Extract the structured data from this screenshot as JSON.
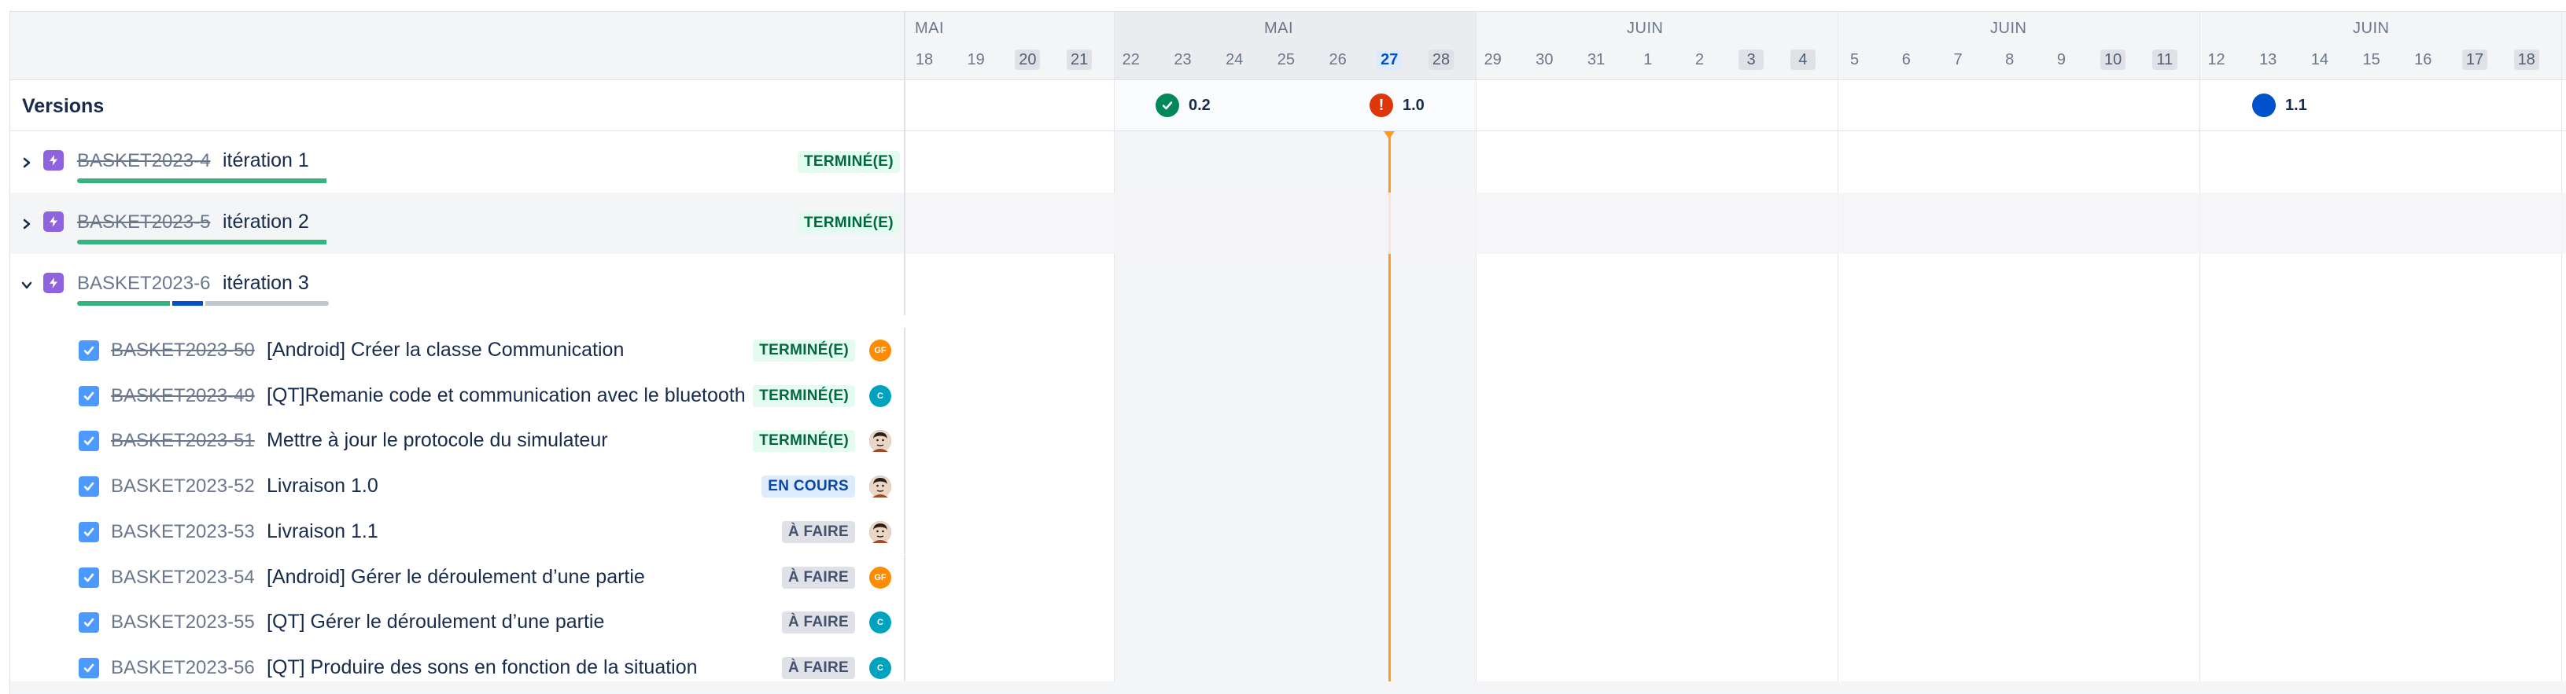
{
  "header": {
    "months": [
      {
        "label": "MAI"
      },
      {
        "label": "MAI"
      },
      {
        "label": "JUIN"
      },
      {
        "label": "JUIN"
      },
      {
        "label": "JUIN"
      }
    ],
    "days": [
      {
        "label": "18",
        "type": "normal"
      },
      {
        "label": "19",
        "type": "normal"
      },
      {
        "label": "20",
        "type": "weekend"
      },
      {
        "label": "21",
        "type": "weekend"
      },
      {
        "label": "22",
        "type": "normal"
      },
      {
        "label": "23",
        "type": "normal"
      },
      {
        "label": "24",
        "type": "normal"
      },
      {
        "label": "25",
        "type": "normal"
      },
      {
        "label": "26",
        "type": "normal"
      },
      {
        "label": "27",
        "type": "today"
      },
      {
        "label": "28",
        "type": "weekend"
      },
      {
        "label": "29",
        "type": "normal"
      },
      {
        "label": "30",
        "type": "normal"
      },
      {
        "label": "31",
        "type": "normal"
      },
      {
        "label": "1",
        "type": "normal"
      },
      {
        "label": "2",
        "type": "normal"
      },
      {
        "label": "3",
        "type": "weekend"
      },
      {
        "label": "4",
        "type": "weekend"
      },
      {
        "label": "5",
        "type": "normal"
      },
      {
        "label": "6",
        "type": "normal"
      },
      {
        "label": "7",
        "type": "normal"
      },
      {
        "label": "8",
        "type": "normal"
      },
      {
        "label": "9",
        "type": "normal"
      },
      {
        "label": "10",
        "type": "weekend"
      },
      {
        "label": "11",
        "type": "weekend"
      },
      {
        "label": "12",
        "type": "normal"
      },
      {
        "label": "13",
        "type": "normal"
      },
      {
        "label": "14",
        "type": "normal"
      },
      {
        "label": "15",
        "type": "normal"
      },
      {
        "label": "16",
        "type": "normal"
      },
      {
        "label": "17",
        "type": "weekend"
      },
      {
        "label": "18",
        "type": "weekend"
      }
    ]
  },
  "versions": {
    "title": "Versions",
    "markers": [
      {
        "label": "0.2",
        "status": "released",
        "color": "#00875a",
        "icon": "check-icon"
      },
      {
        "label": "1.0",
        "status": "overdue",
        "color": "#de350b",
        "icon": "warning-icon"
      },
      {
        "label": "1.1",
        "status": "unreleased",
        "color": "#0052cc",
        "icon": "dot-icon"
      }
    ]
  },
  "epics": [
    {
      "key": "BASKET2023-4",
      "summary": "itération 1",
      "status": "TERMINÉ(E)",
      "done": true,
      "expanded": false,
      "progress": {
        "done": 1.0,
        "in_progress": 0.0,
        "todo": 0.0
      }
    },
    {
      "key": "BASKET2023-5",
      "summary": "itération 2",
      "status": "TERMINÉ(E)",
      "done": true,
      "expanded": false,
      "progress": {
        "done": 1.0,
        "in_progress": 0.0,
        "todo": 0.0
      }
    },
    {
      "key": "BASKET2023-6",
      "summary": "itération 3",
      "status": "",
      "done": false,
      "expanded": true,
      "progress": {
        "done": 0.375,
        "in_progress": 0.125,
        "todo": 0.5
      }
    }
  ],
  "issues": [
    {
      "key": "BASKET2023-50",
      "summary": "[Android] Créer la classe Communication",
      "status": "TERMINÉ(E)",
      "status_type": "done",
      "done": true,
      "assignee": "GF",
      "avatar_color": "#ff8b00"
    },
    {
      "key": "BASKET2023-49",
      "summary": "[QT]Remanie code et communication avec le bluetooth",
      "status": "TERMINÉ(E)",
      "status_type": "done",
      "done": true,
      "assignee": "C",
      "avatar_color": "#00a3bf"
    },
    {
      "key": "BASKET2023-51",
      "summary": "Mettre à jour le protocole du simulateur",
      "status": "TERMINÉ(E)",
      "status_type": "done",
      "done": true,
      "assignee": "",
      "avatar_color": "#5e4b3c"
    },
    {
      "key": "BASKET2023-52",
      "summary": "Livraison 1.0",
      "status": "EN COURS",
      "status_type": "prog",
      "done": false,
      "assignee": "",
      "avatar_color": "#5e4b3c"
    },
    {
      "key": "BASKET2023-53",
      "summary": "Livraison 1.1",
      "status": "À FAIRE",
      "status_type": "todo",
      "done": false,
      "assignee": "",
      "avatar_color": "#5e4b3c"
    },
    {
      "key": "BASKET2023-54",
      "summary": "[Android] Gérer le déroulement d’une partie",
      "status": "À FAIRE",
      "status_type": "todo",
      "done": false,
      "assignee": "GF",
      "avatar_color": "#ff8b00"
    },
    {
      "key": "BASKET2023-55",
      "summary": "[QT] Gérer le déroulement d’une partie",
      "status": "À FAIRE",
      "status_type": "todo",
      "done": false,
      "assignee": "C",
      "avatar_color": "#00a3bf"
    },
    {
      "key": "BASKET2023-56",
      "summary": "[QT] Produire des sons en fonction de la situation",
      "status": "À FAIRE",
      "status_type": "todo",
      "done": false,
      "assignee": "C",
      "avatar_color": "#00a3bf"
    }
  ],
  "colors": {
    "done": "#36b37e",
    "in_progress": "#0052cc",
    "todo": "#c1c7d0",
    "today_line": "#ff991f"
  }
}
